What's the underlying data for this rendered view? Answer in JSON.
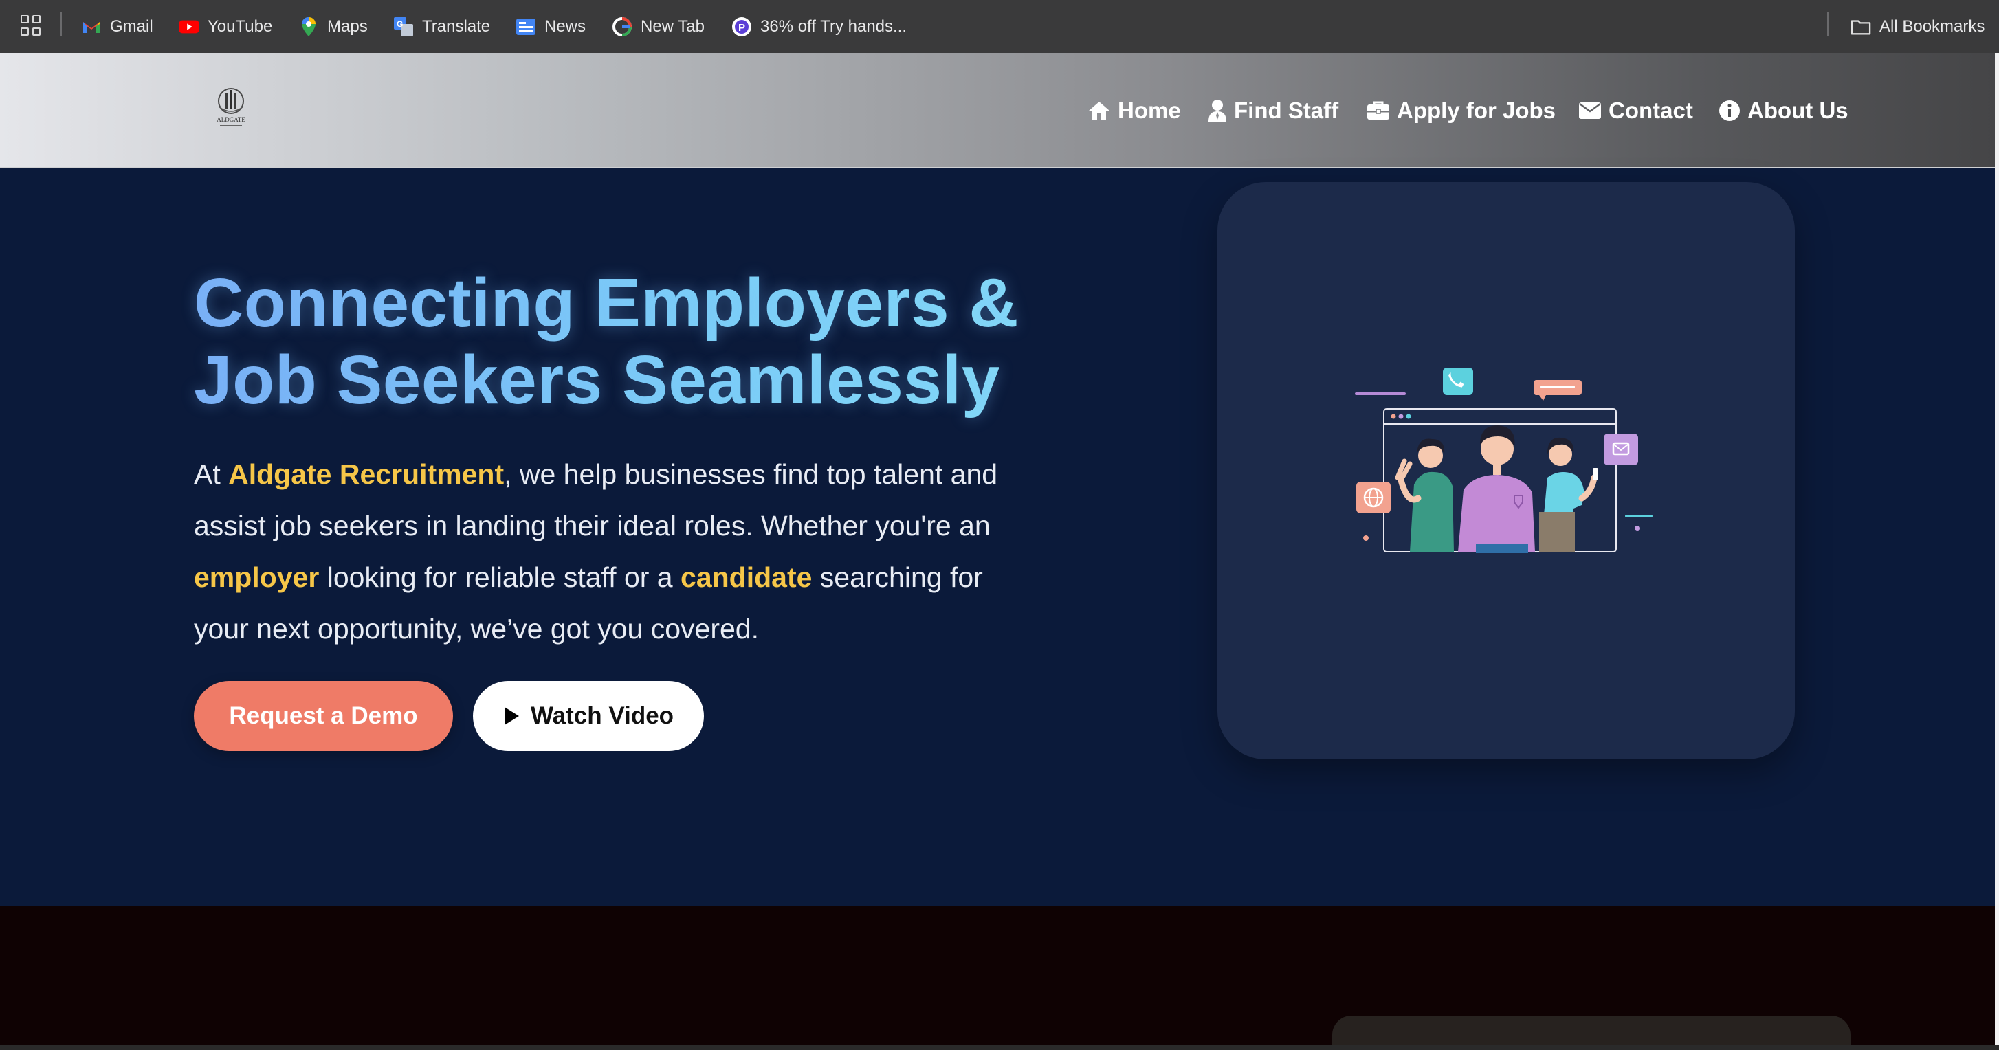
{
  "bookmarks": {
    "items": [
      {
        "label": "Gmail",
        "icon": "gmail-icon"
      },
      {
        "label": "YouTube",
        "icon": "youtube-icon"
      },
      {
        "label": "Maps",
        "icon": "maps-icon"
      },
      {
        "label": "Translate",
        "icon": "translate-icon"
      },
      {
        "label": "News",
        "icon": "news-icon"
      },
      {
        "label": "New Tab",
        "icon": "google-icon"
      },
      {
        "label": "36% off Try hands...",
        "icon": "promo-icon"
      }
    ],
    "all_bookmarks": "All Bookmarks"
  },
  "header": {
    "logo_text": "ALDGATE",
    "nav": [
      {
        "label": "Home",
        "icon": "home-icon"
      },
      {
        "label": "Find Staff",
        "icon": "user-icon"
      },
      {
        "label": "Apply for Jobs",
        "icon": "briefcase-icon"
      },
      {
        "label": "Contact",
        "icon": "envelope-icon"
      },
      {
        "label": "About Us",
        "icon": "info-icon"
      }
    ]
  },
  "hero": {
    "title_line1": "Connecting Employers &",
    "title_line2": "Job Seekers Seamlessly",
    "text_prefix": "At ",
    "brand": "Aldgate Recruitment",
    "text_part1": ", we help businesses find top talent and assist job seekers in landing their ideal roles. Whether you're an ",
    "employer": "employer",
    "text_part2": " looking for reliable staff or a ",
    "candidate": "candidate",
    "text_part3": " searching for your next opportunity, we’ve got you covered.",
    "demo_button": "Request a Demo",
    "video_button": "Watch Video"
  },
  "colors": {
    "hero_bg": "#0b1a3a",
    "card_bg": "#1c2a4a",
    "highlight": "#f6c648",
    "demo_button": "#ef7b67",
    "title_gradient_start": "#7aaef5",
    "title_gradient_end": "#86def6"
  }
}
